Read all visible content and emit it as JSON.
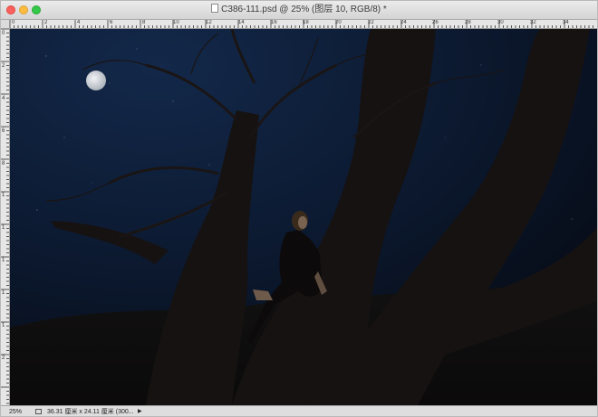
{
  "window": {
    "title": "C386-111.psd @ 25% (图层 10, RGB/8) *",
    "traffic_lights": {
      "close": "#fc605c",
      "minimize": "#fdbc40",
      "maximize": "#34c84a"
    }
  },
  "ruler": {
    "top_labels": [
      "0",
      "2",
      "4",
      "6",
      "8",
      "10",
      "12",
      "14",
      "16",
      "18",
      "20",
      "22",
      "24",
      "26",
      "28",
      "30",
      "32",
      "34"
    ],
    "left_labels": [
      "0",
      "2",
      "4",
      "6",
      "8",
      "1",
      "1",
      "1",
      "1",
      "1",
      "2"
    ]
  },
  "canvas": {
    "description_icons": [
      "moon-icon"
    ],
    "colors": {
      "sky": "#0d1c33",
      "tree": "#161212",
      "ground": "#0e0d0d"
    }
  },
  "statusbar": {
    "zoom": "25%",
    "doc_info": "36.31 厘米 x 24.11 厘米 (300...",
    "arrow": "▶"
  }
}
